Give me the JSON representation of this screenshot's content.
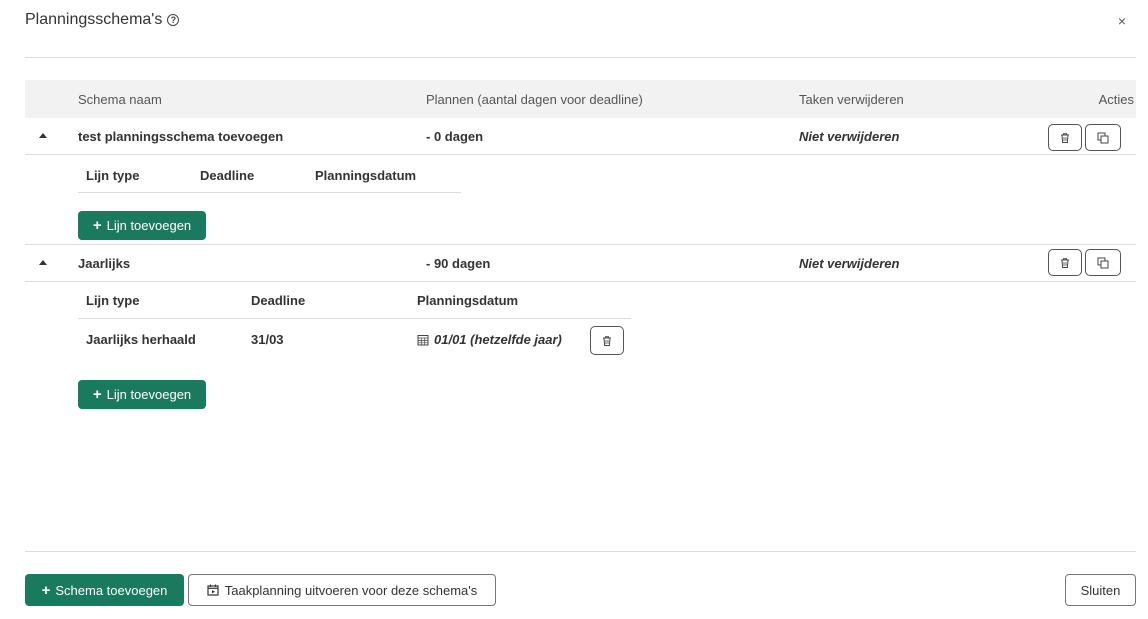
{
  "modal": {
    "title": "Planningsschema's",
    "help_icon": "?",
    "close_label": "×"
  },
  "table": {
    "headers": {
      "name": "Schema naam",
      "plan": "Plannen (aantal dagen voor deadline)",
      "remove": "Taken verwijderen",
      "actions": "Acties"
    },
    "schemas": [
      {
        "name": "test planningsschema toevoegen",
        "days": "- 0 dagen",
        "remove": "Niet verwijderen",
        "lines_headers": [
          "Lijn type",
          "Deadline",
          "Planningsdatum"
        ],
        "lines": [],
        "add_line_label": "Lijn toevoegen"
      },
      {
        "name": "Jaarlijks",
        "days": "- 90 dagen",
        "remove": "Niet verwijderen",
        "lines_headers": [
          "Lijn type",
          "Deadline",
          "Planningsdatum"
        ],
        "lines": [
          {
            "type": "Jaarlijks herhaald",
            "deadline": "31/03",
            "planning": "01/01 (hetzelfde jaar)"
          }
        ],
        "add_line_label": "Lijn toevoegen"
      }
    ]
  },
  "footer": {
    "add_schema_label": "Schema toevoegen",
    "run_planning_label": "Taakplanning uitvoeren voor deze schema's",
    "close_label": "Sluiten"
  },
  "colors": {
    "accent": "#1a7a5e",
    "header_bg": "#f2f2f2",
    "border": "#dcdcdc"
  },
  "icons": {
    "delete": "trash-icon",
    "copy": "copy-icon",
    "calendar": "calendar-icon",
    "play_calendar": "calendar-play-icon"
  }
}
